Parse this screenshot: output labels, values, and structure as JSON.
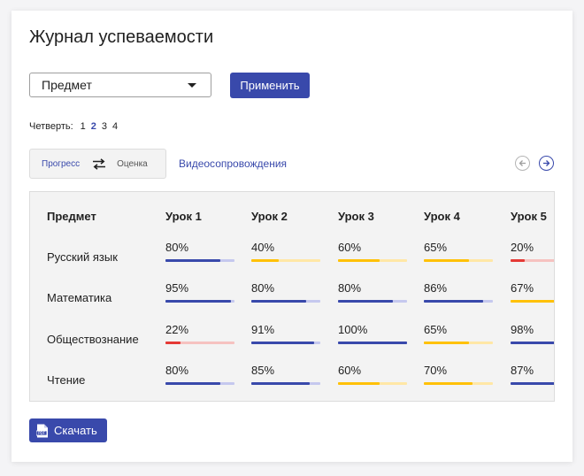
{
  "title": "Журнал успеваемости",
  "subject_select": {
    "value": "Предмет"
  },
  "apply_label": "Применить",
  "quarter": {
    "label": "Четверть:",
    "options": [
      "1",
      "2",
      "3",
      "4"
    ],
    "active": "2"
  },
  "toggle": {
    "left": "Прогресс",
    "right": "Оценка"
  },
  "video_link": "Видеосопровождения",
  "grid": {
    "subject_header": "Предмет",
    "lessons": [
      "Урок 1",
      "Урок 2",
      "Урок 3",
      "Урок 4",
      "Урок 5"
    ],
    "rows": [
      {
        "subject": "Русский язык",
        "scores": [
          "80%",
          "40%",
          "60%",
          "65%",
          "20%"
        ]
      },
      {
        "subject": "Математика",
        "scores": [
          "95%",
          "80%",
          "80%",
          "86%",
          "67%"
        ]
      },
      {
        "subject": "Обществознание",
        "scores": [
          "22%",
          "91%",
          "100%",
          "65%",
          "98%"
        ]
      },
      {
        "subject": "Чтение",
        "scores": [
          "80%",
          "85%",
          "60%",
          "70%",
          "87%"
        ]
      }
    ]
  },
  "colors": {
    "accent": "#3949ab",
    "high": "#3949ab",
    "high_track": "#c5c8ee",
    "mid": "#ffc107",
    "mid_track": "#ffe7a6",
    "low": "#e53935",
    "low_track": "#f6c2c0"
  },
  "download_label": "Скачать",
  "icons": {
    "pdf": "pdf-file-icon",
    "swap": "swap-arrows-icon",
    "prev": "arrow-left-circle-icon",
    "next": "arrow-right-circle-icon"
  }
}
